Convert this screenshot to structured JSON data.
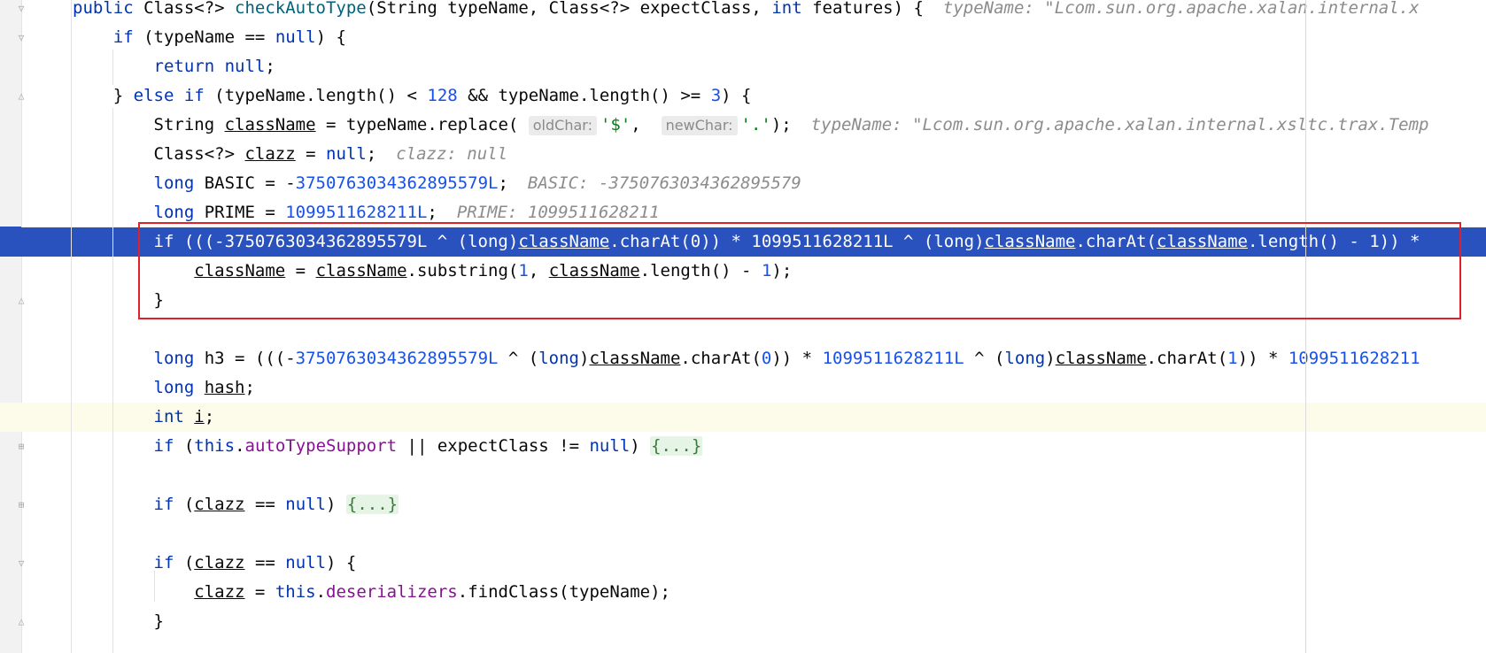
{
  "editor": {
    "lines": [
      {
        "id": "l1",
        "parts": [
          {
            "t": "public ",
            "c": "kw"
          },
          {
            "t": "Class<?> "
          },
          {
            "t": "checkAutoType",
            "c": "fn"
          },
          {
            "t": "(String typeName, Class<?> expectClass, "
          },
          {
            "t": "int ",
            "c": "kw"
          },
          {
            "t": "features) {"
          },
          {
            "t": "typeName: \"Lcom.sun.org.apache.xalan.internal.x",
            "c": "hint"
          }
        ]
      },
      {
        "id": "l2",
        "parts": [
          {
            "t": "    "
          },
          {
            "t": "if ",
            "c": "kw"
          },
          {
            "t": "(typeName == "
          },
          {
            "t": "null",
            "c": "kw"
          },
          {
            "t": ") {"
          }
        ]
      },
      {
        "id": "l3",
        "parts": [
          {
            "t": "        "
          },
          {
            "t": "return ",
            "c": "kw"
          },
          {
            "t": "null",
            "c": "kw"
          },
          {
            "t": ";"
          }
        ]
      },
      {
        "id": "l4",
        "parts": [
          {
            "t": "    } "
          },
          {
            "t": "else if ",
            "c": "kw"
          },
          {
            "t": "(typeName.length() < "
          },
          {
            "t": "128",
            "c": "num"
          },
          {
            "t": " && typeName.length() >= "
          },
          {
            "t": "3",
            "c": "num"
          },
          {
            "t": ") {"
          }
        ]
      },
      {
        "id": "l5",
        "parts": [
          {
            "t": "        String "
          },
          {
            "t": "className",
            "c": "ul"
          },
          {
            "t": " = typeName.replace( "
          },
          {
            "t": "oldChar:",
            "c": "param"
          },
          {
            "t": "'$'",
            "c": "str"
          },
          {
            "t": ",  "
          },
          {
            "t": "newChar:",
            "c": "param"
          },
          {
            "t": "'.'",
            "c": "str"
          },
          {
            "t": ");"
          },
          {
            "t": "typeName: \"Lcom.sun.org.apache.xalan.internal.xsltc.trax.Temp",
            "c": "hint"
          }
        ]
      },
      {
        "id": "l6",
        "parts": [
          {
            "t": "        Class<?> "
          },
          {
            "t": "clazz",
            "c": "ul"
          },
          {
            "t": " = "
          },
          {
            "t": "null",
            "c": "kw"
          },
          {
            "t": ";"
          },
          {
            "t": "clazz: null",
            "c": "hint"
          }
        ]
      },
      {
        "id": "l7",
        "parts": [
          {
            "t": "        "
          },
          {
            "t": "long ",
            "c": "kw"
          },
          {
            "t": "BASIC = -"
          },
          {
            "t": "3750763034362895579L",
            "c": "num"
          },
          {
            "t": ";"
          },
          {
            "t": "BASIC: -3750763034362895579",
            "c": "hint"
          }
        ]
      },
      {
        "id": "l8",
        "parts": [
          {
            "t": "        "
          },
          {
            "t": "long ",
            "c": "kw"
          },
          {
            "t": "PRIME = "
          },
          {
            "t": "1099511628211L",
            "c": "num"
          },
          {
            "t": ";"
          },
          {
            "t": "PRIME: 1099511628211",
            "c": "hint"
          }
        ]
      },
      {
        "id": "l9",
        "parts": [
          {
            "t": "        if (((-3750763034362895579L ^ (long)"
          },
          {
            "t": "className",
            "c": "ul"
          },
          {
            "t": ".charAt(0)) * 1099511628211L ^ (long)"
          },
          {
            "t": "className",
            "c": "ul"
          },
          {
            "t": ".charAt("
          },
          {
            "t": "className",
            "c": "ul"
          },
          {
            "t": ".length() - 1)) *"
          }
        ]
      },
      {
        "id": "l10",
        "parts": [
          {
            "t": "            "
          },
          {
            "t": "className",
            "c": "ul"
          },
          {
            "t": " = "
          },
          {
            "t": "className",
            "c": "ul"
          },
          {
            "t": ".substring("
          },
          {
            "t": "1",
            "c": "num"
          },
          {
            "t": ", "
          },
          {
            "t": "className",
            "c": "ul"
          },
          {
            "t": ".length() - "
          },
          {
            "t": "1",
            "c": "num"
          },
          {
            "t": ");"
          }
        ]
      },
      {
        "id": "l11",
        "parts": [
          {
            "t": "        }"
          }
        ]
      },
      {
        "id": "l12",
        "parts": [
          {
            "t": ""
          }
        ]
      },
      {
        "id": "l13",
        "parts": [
          {
            "t": "        "
          },
          {
            "t": "long ",
            "c": "kw"
          },
          {
            "t": "h3 = (((-"
          },
          {
            "t": "3750763034362895579L",
            "c": "num"
          },
          {
            "t": " ^ ("
          },
          {
            "t": "long",
            "c": "kw"
          },
          {
            "t": ")"
          },
          {
            "t": "className",
            "c": "ul"
          },
          {
            "t": ".charAt("
          },
          {
            "t": "0",
            "c": "num"
          },
          {
            "t": ")) * "
          },
          {
            "t": "1099511628211L",
            "c": "num"
          },
          {
            "t": " ^ ("
          },
          {
            "t": "long",
            "c": "kw"
          },
          {
            "t": ")"
          },
          {
            "t": "className",
            "c": "ul"
          },
          {
            "t": ".charAt("
          },
          {
            "t": "1",
            "c": "num"
          },
          {
            "t": ")) * "
          },
          {
            "t": "1099511628211",
            "c": "num"
          }
        ]
      },
      {
        "id": "l14",
        "parts": [
          {
            "t": "        "
          },
          {
            "t": "long ",
            "c": "kw"
          },
          {
            "t": "hash",
            "c": "ul"
          },
          {
            "t": ";"
          }
        ]
      },
      {
        "id": "l15",
        "parts": [
          {
            "t": "        "
          },
          {
            "t": "int ",
            "c": "kw"
          },
          {
            "t": "i",
            "c": "ul"
          },
          {
            "t": ";"
          }
        ]
      },
      {
        "id": "l16",
        "parts": [
          {
            "t": "        "
          },
          {
            "t": "if ",
            "c": "kw"
          },
          {
            "t": "("
          },
          {
            "t": "this",
            "c": "kw"
          },
          {
            "t": "."
          },
          {
            "t": "autoTypeSupport",
            "c": "fld"
          },
          {
            "t": " || expectClass != "
          },
          {
            "t": "null",
            "c": "kw"
          },
          {
            "t": ") "
          },
          {
            "t": "{...}",
            "c": "folded"
          }
        ]
      },
      {
        "id": "l17",
        "parts": [
          {
            "t": ""
          }
        ]
      },
      {
        "id": "l18",
        "parts": [
          {
            "t": "        "
          },
          {
            "t": "if ",
            "c": "kw"
          },
          {
            "t": "("
          },
          {
            "t": "clazz",
            "c": "ul"
          },
          {
            "t": " == "
          },
          {
            "t": "null",
            "c": "kw"
          },
          {
            "t": ") "
          },
          {
            "t": "{...}",
            "c": "folded"
          }
        ]
      },
      {
        "id": "l19",
        "parts": [
          {
            "t": ""
          }
        ]
      },
      {
        "id": "l20",
        "parts": [
          {
            "t": "        "
          },
          {
            "t": "if ",
            "c": "kw"
          },
          {
            "t": "("
          },
          {
            "t": "clazz",
            "c": "ul"
          },
          {
            "t": " == "
          },
          {
            "t": "null",
            "c": "kw"
          },
          {
            "t": ") {"
          }
        ]
      },
      {
        "id": "l21",
        "parts": [
          {
            "t": "            "
          },
          {
            "t": "clazz",
            "c": "ul"
          },
          {
            "t": " = "
          },
          {
            "t": "this",
            "c": "kw"
          },
          {
            "t": "."
          },
          {
            "t": "deserializers",
            "c": "fld"
          },
          {
            "t": ".findClass(typeName);"
          }
        ]
      },
      {
        "id": "l22",
        "parts": [
          {
            "t": "        }"
          }
        ]
      }
    ],
    "execution_line_index": 8,
    "caret_line_index": 14
  }
}
